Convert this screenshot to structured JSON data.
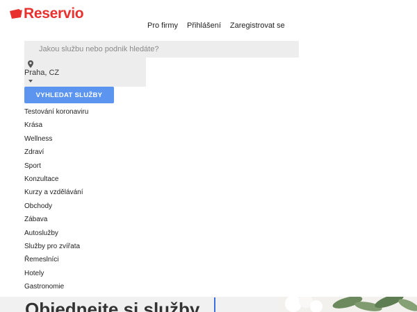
{
  "brand": {
    "name": "Reservio",
    "color": "#e8312f"
  },
  "nav": {
    "items": [
      {
        "label": "Pro firmy"
      },
      {
        "label": "Přihlášení"
      },
      {
        "label": "Zaregistrovat se"
      }
    ]
  },
  "search": {
    "placeholder": "Jakou službu nebo podnik hledáte?",
    "value": ""
  },
  "location": {
    "icon": "map-pin-icon",
    "value": "Praha, CZ"
  },
  "search_button": {
    "label": "VYHLEDAT SLUŽBY",
    "color": "#5b95f0"
  },
  "categories": [
    {
      "label": "Testování koronaviru"
    },
    {
      "label": "Krása"
    },
    {
      "label": "Wellness"
    },
    {
      "label": "Zdraví"
    },
    {
      "label": "Sport"
    },
    {
      "label": "Konzultace"
    },
    {
      "label": "Kurzy a vzdělávání"
    },
    {
      "label": "Obchody"
    },
    {
      "label": "Zábava"
    },
    {
      "label": "Autoslužby"
    },
    {
      "label": "Služby pro zvířata"
    },
    {
      "label": "Řemeslníci"
    },
    {
      "label": "Hotely"
    },
    {
      "label": "Gastronomie"
    }
  ],
  "hero": {
    "title": "Objednejte si služby"
  }
}
